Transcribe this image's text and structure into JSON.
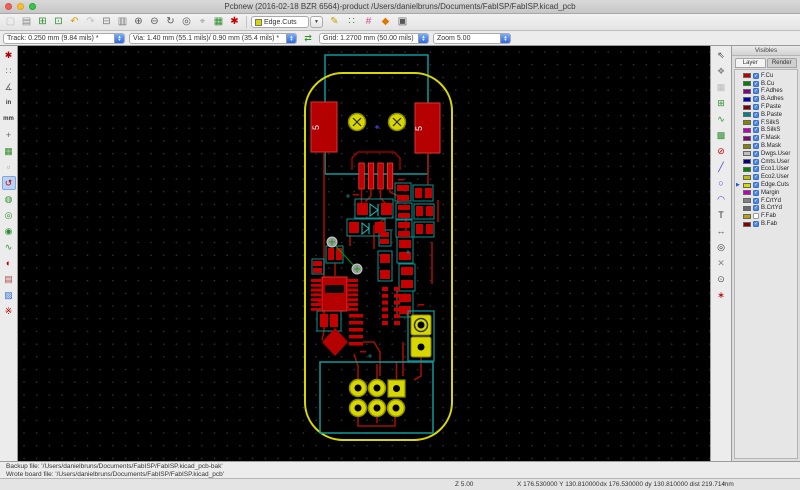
{
  "window": {
    "title": "Pcbnew (2016-02-18 BZR 6564)-product /Users/danielbruns/Documents/FabISP/FabISP.kicad_pcb"
  },
  "toolbar_top": {
    "icons_left": [
      {
        "id": "new-board",
        "glyph": "▢",
        "color": "#c0c0c0"
      },
      {
        "id": "page-settings",
        "glyph": "▤",
        "color": "#8a8a8a"
      },
      {
        "id": "footprint-editor",
        "glyph": "⊞",
        "color": "#2f8f2f"
      },
      {
        "id": "library-browser",
        "glyph": "⊡",
        "color": "#2f8f2f"
      },
      {
        "id": "undo",
        "glyph": "↶",
        "color": "#d0a000"
      },
      {
        "id": "redo",
        "glyph": "↷",
        "color": "#c0c0c0"
      },
      {
        "id": "print",
        "glyph": "⊟",
        "color": "#777777"
      },
      {
        "id": "plot",
        "glyph": "▥",
        "color": "#777777"
      },
      {
        "id": "zoom-in",
        "glyph": "⊕",
        "color": "#555555"
      },
      {
        "id": "zoom-out",
        "glyph": "⊖",
        "color": "#555555"
      },
      {
        "id": "zoom-redraw",
        "glyph": "↻",
        "color": "#555555"
      },
      {
        "id": "zoom-fit",
        "glyph": "◎",
        "color": "#555555"
      },
      {
        "id": "find",
        "glyph": "⌖",
        "color": "#999999"
      },
      {
        "id": "netlist",
        "glyph": "▦",
        "color": "#2f8f2f"
      },
      {
        "id": "drc",
        "glyph": "✱",
        "color": "#c00000"
      }
    ],
    "layer_selector": {
      "label": "Edge.Cuts",
      "swatch": "#d8d800"
    },
    "icons_right": [
      {
        "id": "mode-footprint",
        "glyph": "✎",
        "color": "#c8a000"
      },
      {
        "id": "grid-style-dots",
        "glyph": "∷",
        "color": "#2f8f2f"
      },
      {
        "id": "grid-style-lines",
        "glyph": "#",
        "color": "#d04f8f"
      },
      {
        "id": "mode-track",
        "glyph": "◆",
        "color": "#e07800"
      },
      {
        "id": "layers-manager-toggle",
        "glyph": "▣",
        "color": "#555555"
      }
    ]
  },
  "toolbar_params": {
    "track": "Track: 0.250 mm (9.84 mils) *",
    "via": "Via: 1.40 mm (55.1 mils)/ 0.90 mm (35.4 mils) *",
    "grid": "Grid: 1.2700 mm (50.00 mils)",
    "zoom": "Zoom 5.00",
    "auto_width_icon": {
      "id": "auto-track-width",
      "glyph": "⇄",
      "color": "#2f8f2f"
    }
  },
  "left_toolbar": {
    "icons": [
      {
        "id": "drc-toggle",
        "glyph": "✱",
        "color": "#b00000"
      },
      {
        "id": "grid-visibility",
        "glyph": "∷",
        "color": "#666666"
      },
      {
        "id": "polar-coordinates",
        "glyph": "∡",
        "color": "#666666"
      },
      {
        "id": "units-inch",
        "glyph": "in",
        "color": "#333333",
        "text": true
      },
      {
        "id": "units-mm",
        "glyph": "mm",
        "color": "#333333",
        "text": true
      },
      {
        "id": "cursor-shape",
        "glyph": "+",
        "color": "#666666"
      },
      {
        "id": "general-ratsnest",
        "glyph": "▦",
        "color": "#2f8f2f"
      },
      {
        "id": "module-ratsnest",
        "glyph": "▫",
        "color": "#999999"
      },
      {
        "id": "auto-delete-track",
        "glyph": "↺",
        "color": "#b00000",
        "active": true
      },
      {
        "id": "zones-filled",
        "glyph": "◍",
        "color": "#2f8f2f"
      },
      {
        "id": "pads-sketch",
        "glyph": "◎",
        "color": "#2f8f2f"
      },
      {
        "id": "vias-sketch",
        "glyph": "◉",
        "color": "#2f8f2f"
      },
      {
        "id": "tracks-sketch",
        "glyph": "∿",
        "color": "#2f8f2f"
      },
      {
        "id": "high-contrast",
        "glyph": "◐",
        "color": "#b00000"
      },
      {
        "id": "layers-manager",
        "glyph": "▤",
        "color": "#b05050"
      },
      {
        "id": "microwave-tools",
        "glyph": "▨",
        "color": "#2f6fd0"
      },
      {
        "id": "hidden-text",
        "glyph": "※",
        "color": "#b00000"
      }
    ]
  },
  "right_toolbar": {
    "icons": [
      {
        "id": "select-tool",
        "glyph": "⇖",
        "color": "#444444"
      },
      {
        "id": "highlight-net",
        "glyph": "❖",
        "color": "#888888"
      },
      {
        "id": "local-ratsnest",
        "glyph": "▦",
        "color": "#bbbbbb"
      },
      {
        "id": "add-footprint",
        "glyph": "⊞",
        "color": "#2f8f2f"
      },
      {
        "id": "add-track",
        "glyph": "∿",
        "color": "#2f8f2f"
      },
      {
        "id": "add-zone",
        "glyph": "▩",
        "color": "#2f8f2f"
      },
      {
        "id": "add-keepout",
        "glyph": "⊘",
        "color": "#c00000"
      },
      {
        "id": "add-line",
        "glyph": "╱",
        "color": "#3a3ad0"
      },
      {
        "id": "add-circle",
        "glyph": "○",
        "color": "#3a3ad0"
      },
      {
        "id": "add-arc",
        "glyph": "◠",
        "color": "#3a3ad0"
      },
      {
        "id": "add-text",
        "glyph": "T",
        "color": "#333333"
      },
      {
        "id": "add-dimension",
        "glyph": "↔",
        "color": "#555555"
      },
      {
        "id": "add-target",
        "glyph": "◎",
        "color": "#333333"
      },
      {
        "id": "delete-tool",
        "glyph": "✕",
        "color": "#888888"
      },
      {
        "id": "drill-origin",
        "glyph": "⊙",
        "color": "#555555"
      },
      {
        "id": "grid-origin",
        "glyph": "∗",
        "color": "#b00000"
      }
    ]
  },
  "layers_panel": {
    "title": "Visibles",
    "tabs": [
      "Layer",
      "Render"
    ],
    "active_tab": "Layer",
    "layers": [
      {
        "name": "F.Cu",
        "color": "#c00000",
        "checked": true
      },
      {
        "name": "B.Cu",
        "color": "#008400",
        "checked": true
      },
      {
        "name": "F.Adhes",
        "color": "#840084",
        "checked": true
      },
      {
        "name": "B.Adhes",
        "color": "#0000c0",
        "checked": true
      },
      {
        "name": "F.Paste",
        "color": "#840000",
        "checked": true
      },
      {
        "name": "B.Paste",
        "color": "#008484",
        "checked": true
      },
      {
        "name": "F.SilkS",
        "color": "#848400",
        "checked": true
      },
      {
        "name": "B.SilkS",
        "color": "#c000c0",
        "checked": true
      },
      {
        "name": "F.Mask",
        "color": "#840084",
        "checked": true
      },
      {
        "name": "B.Mask",
        "color": "#848400",
        "checked": true
      },
      {
        "name": "Dwgs.User",
        "color": "#c0c0c0",
        "checked": true
      },
      {
        "name": "Cmts.User",
        "color": "#000084",
        "checked": true
      },
      {
        "name": "Eco1.User",
        "color": "#008400",
        "checked": true
      },
      {
        "name": "Eco2.User",
        "color": "#c0c000",
        "checked": true
      },
      {
        "name": "Edge.Cuts",
        "color": "#d8d800",
        "checked": true,
        "current": true
      },
      {
        "name": "Margin",
        "color": "#c000c0",
        "checked": true
      },
      {
        "name": "F.CrtYd",
        "color": "#808080",
        "checked": true
      },
      {
        "name": "B.CrtYd",
        "color": "#6a6a6a",
        "checked": true
      },
      {
        "name": "F.Fab",
        "color": "#b8a000",
        "checked": false
      },
      {
        "name": "B.Fab",
        "color": "#840000",
        "checked": true
      }
    ]
  },
  "board": {
    "labels": {
      "usb_pad_left": "5",
      "usb_pad_right": "5"
    },
    "colors": {
      "copper_front": "#c40000",
      "copper_dim": "#9a1200",
      "edge_cuts": "#d8d800",
      "courtyard": "#0e8f8f",
      "th_pad": "#d8d800",
      "ratsnest": "#00a000",
      "grid_dot": "#35353b",
      "test_point": "#9a9a9a",
      "marker_blue": "#4a4af0"
    }
  },
  "messages": {
    "line1": "Backup file: '/Users/danielbruns/Documents/FabISP/FabISP.kicad_pcb-bak'",
    "line2": "Wrote board file: '/Users/danielbruns/Documents/FabISP/FabISP.kicad_pcb'"
  },
  "status_bar": {
    "zoom": "Z 5.00",
    "cursor": "X 176.530000 Y 130.810000",
    "delta": "dx 176.530000 dy 130.810000 dist 219.714",
    "units": "mm"
  }
}
